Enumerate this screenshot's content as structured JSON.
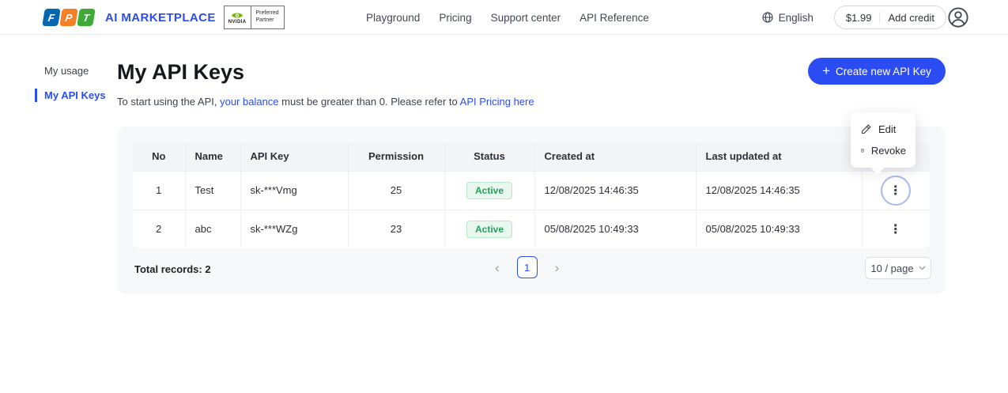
{
  "colors": {
    "accent_blue": "#2b4cf2",
    "fpt_blue": "#0468b1",
    "fpt_orange": "#f58025",
    "fpt_green": "#3dab35",
    "nvidia_green": "#76b900",
    "status_active_bg": "#e8f8ee",
    "status_active_border": "#b9e9cb",
    "status_active_text": "#27a05a",
    "card_bg": "#f7f8fa"
  },
  "icons": {
    "globe": "svg-globe",
    "avatar": "svg-person-circle",
    "plus": "+",
    "kebab": "⋮",
    "chevron_left": "‹",
    "chevron_right": "›",
    "chevron_down": "svg-chevron-down",
    "edit": "svg-pencil",
    "revoke": "svg-trash"
  },
  "header": {
    "brand": {
      "letters": {
        "f": "F",
        "p": "P",
        "t": "T"
      },
      "title": "AI MARKETPLACE",
      "nvidia": {
        "word": "NVIDIA",
        "line1": "Preferred",
        "line2": "Partner"
      }
    },
    "nav": {
      "playground": "Playground",
      "pricing": "Pricing",
      "support": "Support center",
      "api_reference": "API Reference"
    },
    "language": "English",
    "balance": "$1.99",
    "add_credit": "Add credit"
  },
  "sidebar": {
    "my_usage": "My usage",
    "my_api_keys": "My API Keys"
  },
  "main": {
    "title": "My API Keys",
    "subtitle": {
      "part1": "To start using the API,",
      "link1": "your balance",
      "part2": "must be greater than 0. Please refer to",
      "link2": "API Pricing here"
    },
    "create_button": "Create new API Key"
  },
  "table": {
    "columns": {
      "no": "No",
      "name": "Name",
      "api_key": "API Key",
      "permission": "Permission",
      "status": "Status",
      "created_at": "Created at",
      "updated_at": "Last updated at"
    },
    "rows": [
      {
        "no": "1",
        "name": "Test",
        "api_key": "sk-***Vmg",
        "permission": "25",
        "status": "Active",
        "created_at": "12/08/2025 14:46:35",
        "updated_at": "12/08/2025 14:46:35"
      },
      {
        "no": "2",
        "name": "abc",
        "api_key": "sk-***WZg",
        "permission": "23",
        "status": "Active",
        "created_at": "05/08/2025 10:49:33",
        "updated_at": "05/08/2025 10:49:33"
      }
    ],
    "footer": {
      "total": "Total records: 2",
      "current_page": "1",
      "page_size": "10 / page"
    }
  },
  "context_menu": {
    "edit": "Edit",
    "revoke": "Revoke"
  }
}
